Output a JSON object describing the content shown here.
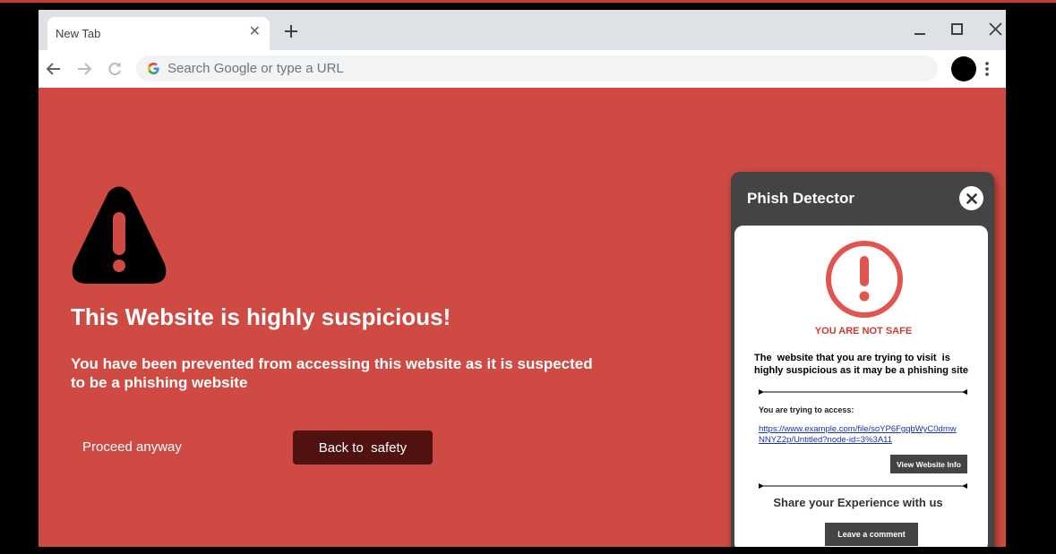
{
  "browser": {
    "tab_title": "New Tab",
    "omnibox_placeholder": "Search Google or type a URL"
  },
  "page": {
    "heading": "This Website is highly suspicious!",
    "subtext": "You have been prevented from accessing this website as it is suspected to be a phishing website",
    "proceed_label": "Proceed anyway",
    "back_label": "Back to  safety",
    "background_color": "#cf4a42"
  },
  "extension": {
    "title": "Phish Detector",
    "status": "YOU ARE NOT SAFE",
    "warning": "The  website that you are trying to visit  is\nhighly suspicious as it may be a phishing site",
    "access_label": "You are trying to access:",
    "url": "https://www.example.com/file/soYP6FgqbWyC0dmwNNYZ2p/Untitled?node-id=3%3A11",
    "view_info_label": "View Website Info",
    "share_text": "Share your Experience with us",
    "comment_label": "Leave a comment",
    "status_color": "#cf3b33"
  }
}
